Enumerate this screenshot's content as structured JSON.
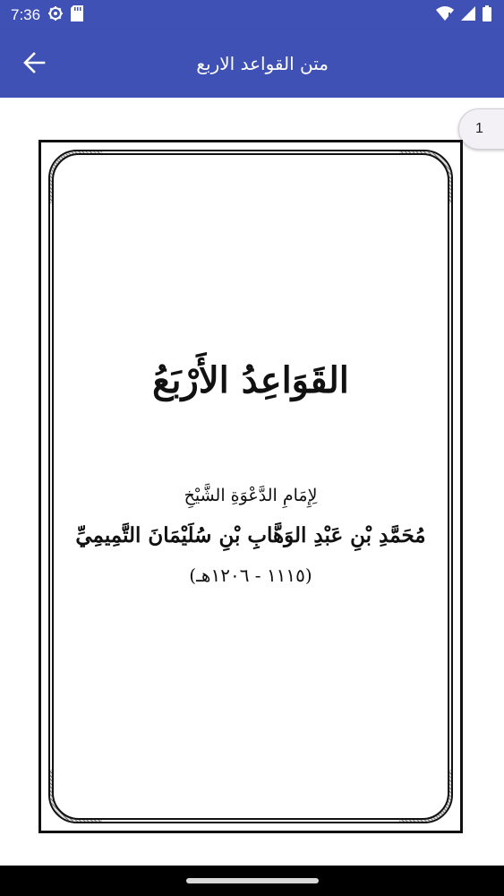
{
  "status_bar": {
    "time": "7:36",
    "icons": [
      "settings-gear-icon",
      "sd-card-icon",
      "wifi-icon",
      "signal-icon",
      "battery-icon"
    ]
  },
  "app_bar": {
    "title": "متن القواعد الاربع",
    "back_icon": "arrow-left-icon",
    "color": "#3f51b5"
  },
  "viewer": {
    "page_number": "1",
    "page": {
      "title": "القَوَاعِدُ الأَرْبَعُ",
      "author_line1": "لِإِمَامِ الدَّعْوَةِ الشَّيْخِ",
      "author_line2": "مُحَمَّدِ بْنِ عَبْدِ الوَهَّابِ بْنِ سُلَيْمَانَ التَّمِيمِيِّ",
      "author_line3": "(١١١٥ - ١٢٠٦هـ)"
    }
  }
}
